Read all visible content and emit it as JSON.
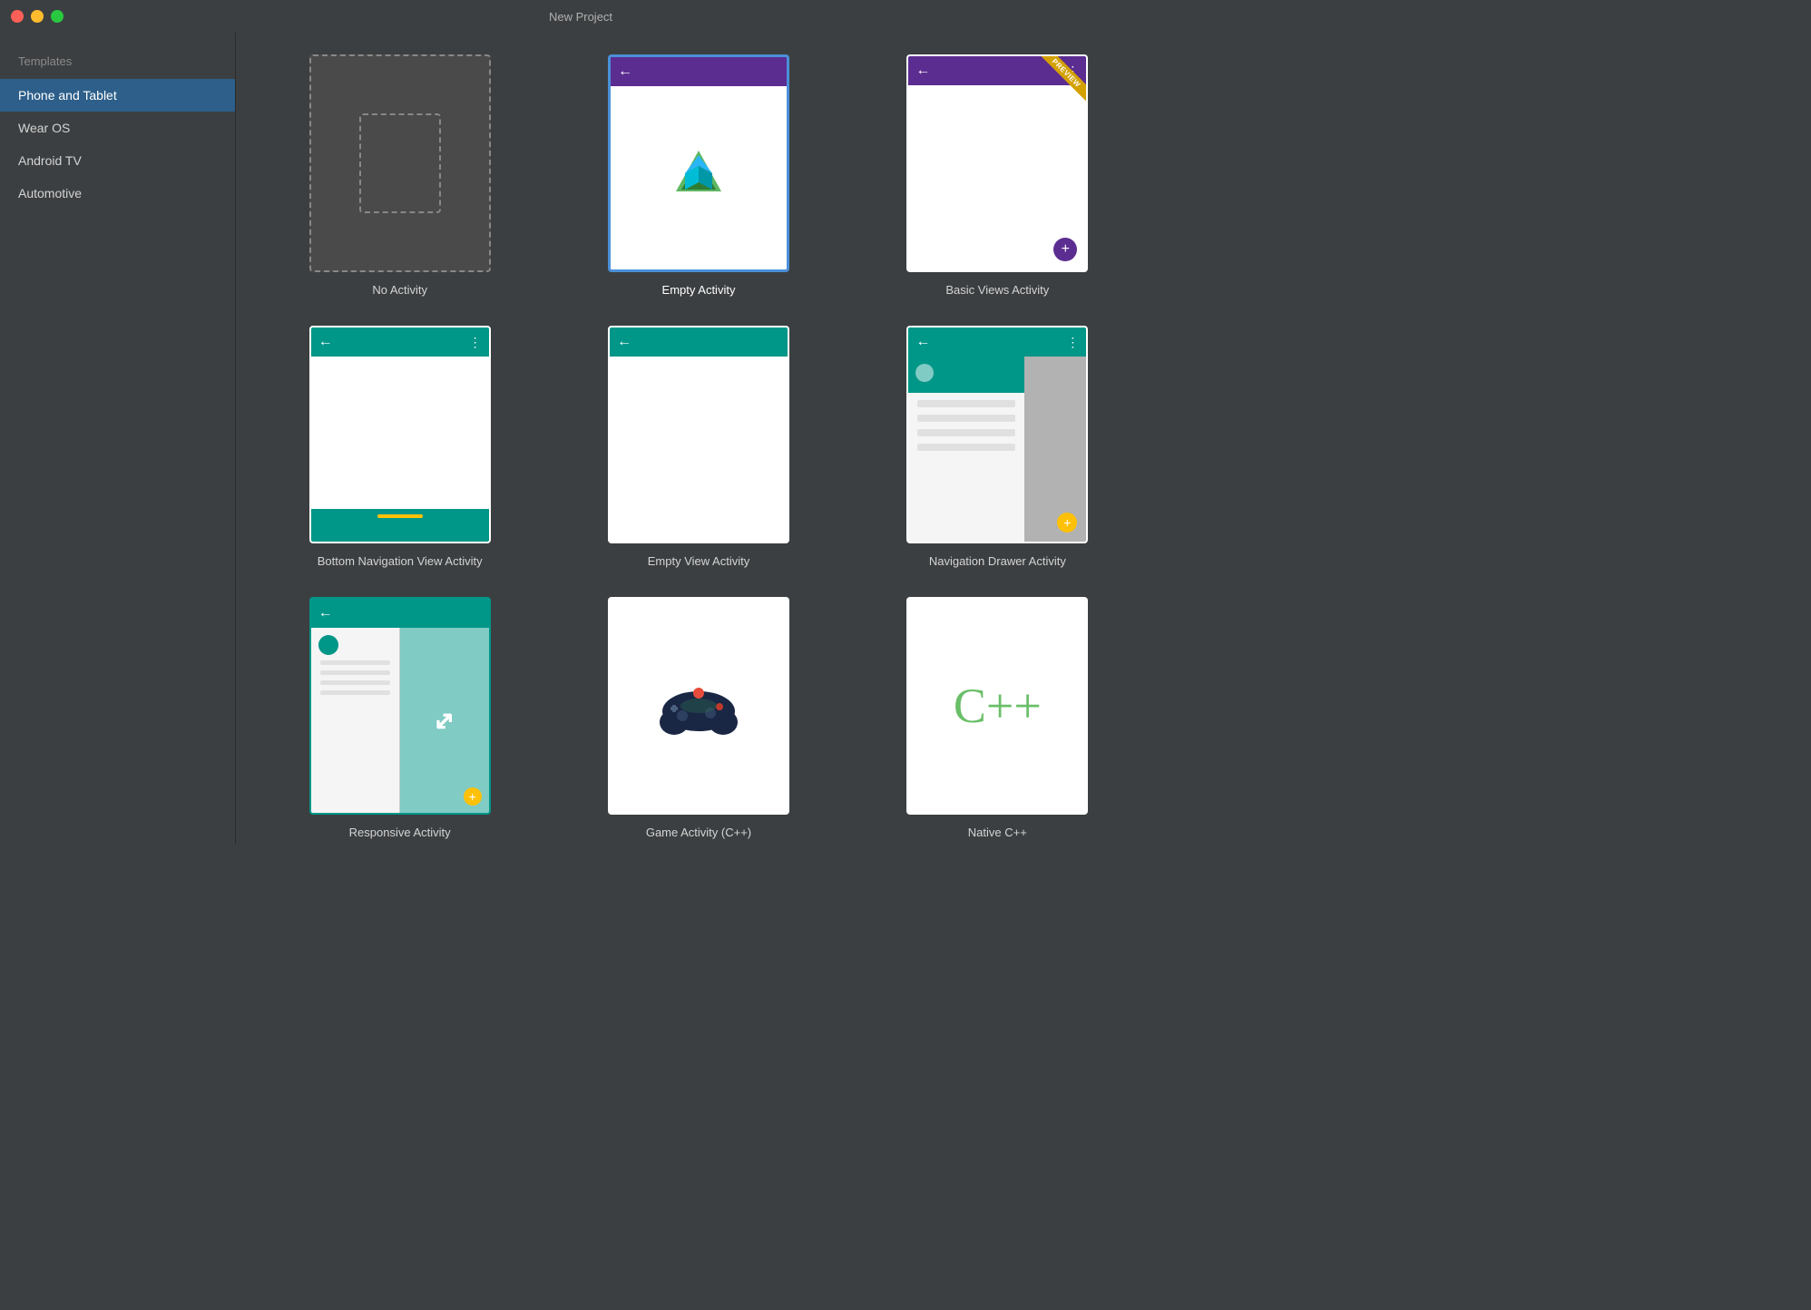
{
  "window": {
    "title": "New Project"
  },
  "titlebar": {
    "buttons": {
      "close_label": "close",
      "minimize_label": "minimize",
      "maximize_label": "maximize"
    }
  },
  "sidebar": {
    "section_label": "Templates",
    "items": [
      {
        "id": "phone-tablet",
        "label": "Phone and Tablet",
        "active": true
      },
      {
        "id": "wear-os",
        "label": "Wear OS",
        "active": false
      },
      {
        "id": "android-tv",
        "label": "Android TV",
        "active": false
      },
      {
        "id": "automotive",
        "label": "Automotive",
        "active": false
      }
    ]
  },
  "templates": {
    "items": [
      {
        "id": "no-activity",
        "label": "No Activity"
      },
      {
        "id": "empty-activity",
        "label": "Empty Activity",
        "selected": true
      },
      {
        "id": "basic-views-activity",
        "label": "Basic Views Activity"
      },
      {
        "id": "bottom-nav-activity",
        "label": "Bottom Navigation View Activity"
      },
      {
        "id": "empty-view-activity",
        "label": "Empty View Activity"
      },
      {
        "id": "nav-drawer-activity",
        "label": "Navigation Drawer Activity"
      },
      {
        "id": "responsive-activity",
        "label": "Responsive Activity"
      },
      {
        "id": "game-activity",
        "label": "Game Activity (C++)"
      },
      {
        "id": "native-cpp",
        "label": "Native C++"
      }
    ]
  }
}
